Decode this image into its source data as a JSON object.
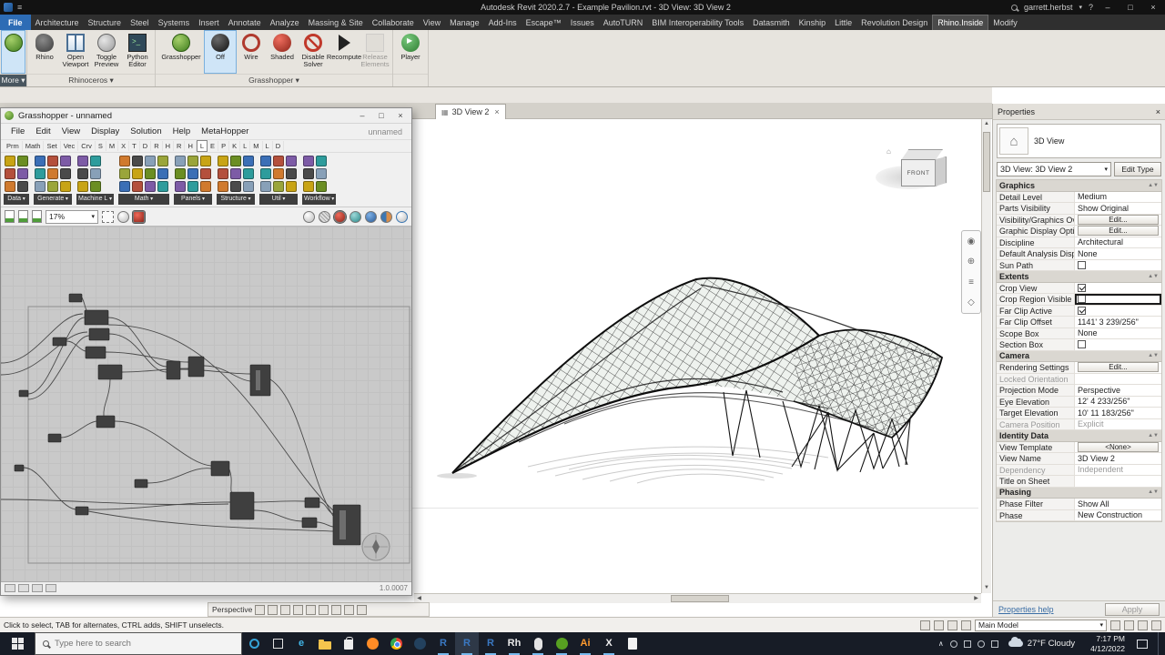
{
  "titlebar": {
    "title": "Autodesk Revit 2020.2.7 - Example Pavilion.rvt - 3D View: 3D View 2",
    "user": "garrett.herbst",
    "help": "?"
  },
  "ribbon": {
    "more_label": "More",
    "tabs": [
      {
        "label": "File",
        "style": "file"
      },
      {
        "label": "Architecture"
      },
      {
        "label": "Structure"
      },
      {
        "label": "Steel"
      },
      {
        "label": "Systems"
      },
      {
        "label": "Insert"
      },
      {
        "label": "Annotate"
      },
      {
        "label": "Analyze"
      },
      {
        "label": "Massing & Site"
      },
      {
        "label": "Collaborate"
      },
      {
        "label": "View"
      },
      {
        "label": "Manage"
      },
      {
        "label": "Add-Ins"
      },
      {
        "label": "Escape™"
      },
      {
        "label": "Issues"
      },
      {
        "label": "AutoTURN"
      },
      {
        "label": "BIM Interoperability Tools"
      },
      {
        "label": "Datasmith"
      },
      {
        "label": "Kinship"
      },
      {
        "label": "Little"
      },
      {
        "label": "Revolution Design"
      },
      {
        "label": "Rhino.Inside",
        "active": true
      },
      {
        "label": "Modify"
      }
    ],
    "panels": [
      {
        "label": "Rhinoceros",
        "buttons": [
          {
            "label": "Rhino",
            "icon": "rhino"
          },
          {
            "label": "Open Viewport",
            "icon": "viewport"
          },
          {
            "label": "Toggle Preview",
            "icon": "preview"
          },
          {
            "label": "Python Editor",
            "icon": "python"
          }
        ]
      },
      {
        "label": "Grasshopper",
        "buttons": [
          {
            "label": "Grasshopper",
            "icon": "gh",
            "wide": true
          },
          {
            "label": "Off",
            "icon": "off",
            "selected": true
          },
          {
            "label": "Wire",
            "icon": "wire"
          },
          {
            "label": "Shaded",
            "icon": "shaded"
          },
          {
            "label": "Disable Solver",
            "icon": "disable"
          },
          {
            "label": "Recompute",
            "icon": "recompute"
          },
          {
            "label": "Release Elements",
            "icon": "release",
            "disabled": true
          }
        ]
      },
      {
        "label": "",
        "buttons": [
          {
            "label": "Player",
            "icon": "player"
          }
        ]
      }
    ]
  },
  "grasshopper": {
    "title": "Grasshopper - unnamed",
    "doc_name": "unnamed",
    "menus": [
      "File",
      "Edit",
      "View",
      "Display",
      "Solution",
      "Help",
      "MetaHopper"
    ],
    "category_tabs": [
      "Prm",
      "Math",
      "Set",
      "Vec",
      "Crv",
      "S",
      "M",
      "X",
      "T",
      "D",
      "R",
      "H",
      "R",
      "H",
      "L",
      "E",
      "P",
      "K",
      "L",
      "M",
      "L",
      "D"
    ],
    "selected_tab_index": 14,
    "palette_groups": [
      {
        "label": "Data",
        "cols": 2
      },
      {
        "label": "Generate",
        "cols": 3
      },
      {
        "label": "Machine L",
        "cols": 2
      },
      {
        "label": "Math",
        "cols": 4
      },
      {
        "label": "Panels",
        "cols": 3
      },
      {
        "label": "Structure",
        "cols": 3
      },
      {
        "label": "Util",
        "cols": 3
      },
      {
        "label": "Workflow",
        "cols": 2
      }
    ],
    "icon_colors": [
      "#c8a415",
      "#6b8e23",
      "#3b6fb6",
      "#b4503c",
      "#7d5ba6",
      "#2e9c9c",
      "#d07a2e",
      "#4a4a4a",
      "#88a0b8",
      "#9aa53a"
    ],
    "zoom": "17%",
    "version": "1.0.0007"
  },
  "viewport": {
    "tab_label": "3D View 2",
    "viewcube_face": "FRONT",
    "view_control_label": "Perspective"
  },
  "properties": {
    "title": "Properties",
    "view_type_label": "3D View",
    "type_selector": "3D View: 3D View 2",
    "edit_type_label": "Edit Type",
    "help_label": "Properties help",
    "apply_label": "Apply",
    "rows": [
      {
        "type": "header",
        "label": "Graphics"
      },
      {
        "type": "text",
        "label": "Detail Level",
        "value": "Medium"
      },
      {
        "type": "text",
        "label": "Parts Visibility",
        "value": "Show Original"
      },
      {
        "type": "button",
        "label": "Visibility/Graphics Ov...",
        "value": "Edit..."
      },
      {
        "type": "button",
        "label": "Graphic Display Opti...",
        "value": "Edit..."
      },
      {
        "type": "text",
        "label": "Discipline",
        "value": "Architectural"
      },
      {
        "type": "text",
        "label": "Default Analysis Displ...",
        "value": "None"
      },
      {
        "type": "check",
        "label": "Sun Path",
        "checked": false
      },
      {
        "type": "header",
        "label": "Extents"
      },
      {
        "type": "check",
        "label": "Crop View",
        "checked": true
      },
      {
        "type": "check",
        "label": "Crop Region Visible",
        "checked": false,
        "selected": true
      },
      {
        "type": "check",
        "label": "Far Clip Active",
        "checked": true
      },
      {
        "type": "text",
        "label": "Far Clip Offset",
        "value": "1141'  3 239/256\""
      },
      {
        "type": "text",
        "label": "Scope Box",
        "value": "None"
      },
      {
        "type": "check",
        "label": "Section Box",
        "checked": false
      },
      {
        "type": "header",
        "label": "Camera"
      },
      {
        "type": "button",
        "label": "Rendering Settings",
        "value": "Edit..."
      },
      {
        "type": "text",
        "label": "Locked Orientation",
        "value": "",
        "grayed": true
      },
      {
        "type": "text",
        "label": "Projection Mode",
        "value": "Perspective"
      },
      {
        "type": "text",
        "label": "Eye Elevation",
        "value": "12'  4 233/256\""
      },
      {
        "type": "text",
        "label": "Target Elevation",
        "value": "10'  11 183/256\""
      },
      {
        "type": "text",
        "label": "Camera Position",
        "value": "Explicit",
        "grayed": true
      },
      {
        "type": "header",
        "label": "Identity Data"
      },
      {
        "type": "button",
        "label": "View Template",
        "value": "<None>"
      },
      {
        "type": "text",
        "label": "View Name",
        "value": "3D View 2"
      },
      {
        "type": "text",
        "label": "Dependency",
        "value": "Independent",
        "grayed": true
      },
      {
        "type": "text",
        "label": "Title on Sheet",
        "value": ""
      },
      {
        "type": "header",
        "label": "Phasing"
      },
      {
        "type": "text",
        "label": "Phase Filter",
        "value": "Show All"
      },
      {
        "type": "text",
        "label": "Phase",
        "value": "New Construction"
      }
    ]
  },
  "statusbar": {
    "hint": "Click to select, TAB for alternates, CTRL adds, SHIFT unselects.",
    "main_model": "Main Model"
  },
  "taskbar": {
    "search_placeholder": "Type here to search",
    "weather": "27°F Cloudy",
    "time": "7:17 PM",
    "date": "4/12/2022",
    "icons": [
      {
        "name": "cortana-icon",
        "shape": "ring",
        "color": "#35a3d8"
      },
      {
        "name": "task-view-icon",
        "shape": "sq"
      },
      {
        "name": "edge-icon",
        "glyph": "e",
        "fg": "#41b6e8"
      },
      {
        "name": "file-explorer-icon",
        "shape": "folder"
      },
      {
        "name": "store-icon",
        "shape": "bag"
      },
      {
        "name": "firefox-icon",
        "shape": "circle",
        "color": "#ff8c26"
      },
      {
        "name": "chrome-icon",
        "shape": "chrome"
      },
      {
        "name": "steam-icon",
        "shape": "circle",
        "color": "#23415e"
      },
      {
        "name": "revit-icon",
        "glyph": "R",
        "fg": "#3a78c2",
        "open": true
      },
      {
        "name": "revit-icon",
        "glyph": "R",
        "fg": "#3a78c2",
        "open": true,
        "active": true
      },
      {
        "name": "revit-icon",
        "glyph": "R",
        "fg": "#3a78c2",
        "open": true
      },
      {
        "name": "rhino-icon",
        "glyph": "Rh",
        "fg": "#e8e8e8",
        "open": true
      },
      {
        "name": "mouse-icon",
        "shape": "pill",
        "open": true
      },
      {
        "name": "grasshopper-icon",
        "shape": "circle",
        "color": "#57a021",
        "open": true
      },
      {
        "name": "illustrator-icon",
        "glyph": "Ai",
        "fg": "#ff9a2e",
        "open": true
      },
      {
        "name": "app-x-icon",
        "glyph": "X",
        "fg": "#eeeeee",
        "open": true
      },
      {
        "name": "notes-icon",
        "shape": "doc"
      }
    ]
  }
}
